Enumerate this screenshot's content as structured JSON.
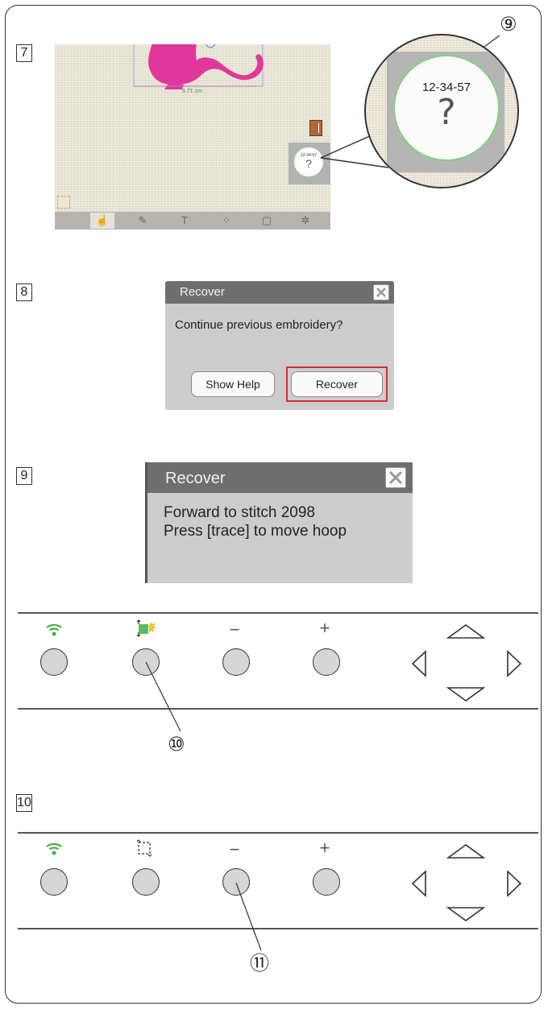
{
  "steps": {
    "s7": "7",
    "s8": "8",
    "s9": "9",
    "s10": "10"
  },
  "callouts": {
    "c9": "⑨",
    "c10": "⑩",
    "c11": "⑪"
  },
  "screen": {
    "dimension_label": "5.71 cm",
    "icon_code": "12-34-57",
    "icon_symbol": "?",
    "tabs": [
      "hand-icon",
      "palette-icon",
      "text-icon",
      "pattern-icon",
      "hoop-icon",
      "settings-icon"
    ]
  },
  "zoom": {
    "code": "12-34-57",
    "symbol": "?"
  },
  "dialog_recover_1": {
    "title": "Recover",
    "message": "Continue previous embroidery?",
    "show_help_label": "Show Help",
    "recover_label": "Recover"
  },
  "dialog_recover_2": {
    "title": "Recover",
    "line1": "Forward to stitch 2098",
    "line2": "Press [trace] to move hoop"
  },
  "panel_1": {
    "icons": [
      "wifi-icon",
      "trace-icon-active",
      "minus-icon",
      "plus-icon"
    ],
    "minus": "−",
    "plus": "+"
  },
  "panel_2": {
    "icons": [
      "wifi-icon",
      "trace-icon",
      "minus-icon",
      "plus-icon"
    ],
    "minus": "−",
    "plus": "+"
  },
  "colors": {
    "accent_green": "#4caf50",
    "recover_highlight": "#d32f2f",
    "cat_pink": "#e0389a"
  }
}
